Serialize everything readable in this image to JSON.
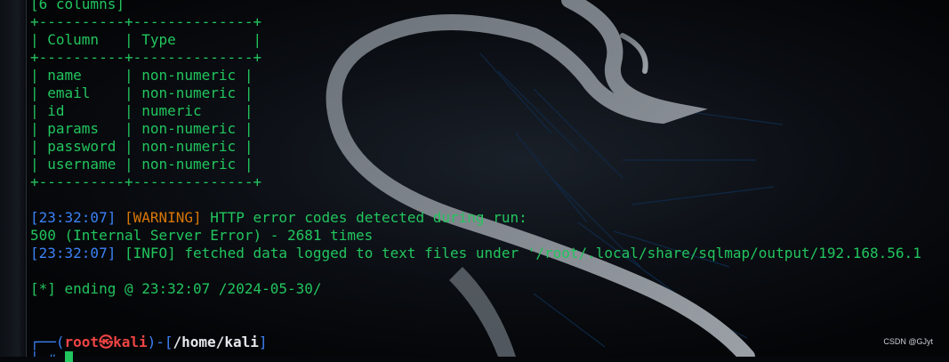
{
  "terminal": {
    "header_line": "[6 columns]",
    "table": {
      "border_top": "+----------+--------------+",
      "header_row": "| Column   | Type         |",
      "border_mid": "+----------+--------------+",
      "rows": [
        "| name     | non-numeric |",
        "| email    | non-numeric |",
        "| id       | numeric     |",
        "| params   | non-numeric |",
        "| password | non-numeric |",
        "| username | non-numeric |"
      ],
      "border_bottom": "+----------+--------------+"
    },
    "log": {
      "warning_time": "[23:32:07]",
      "warning_tag": "[WARNING]",
      "warning_msg": " HTTP error codes detected during run:",
      "error_line": "500 (Internal Server Error) - 2681 times",
      "info_time": "[23:32:07]",
      "info_tag": "[INFO]",
      "info_msg_prefix": " fetched data logged to text files under '",
      "info_path": "/root/.local/share/sqlmap/output/192.168.56.1"
    },
    "ending_line": "[*] ending @ 23:32:07 /2024-05-30/",
    "prompt": {
      "corner": "┌──(",
      "user": "root",
      "skull": "㉿",
      "host": "kali",
      "sep": ")-[",
      "cwd": "/home/kali",
      "close": "]",
      "second_line": "└─#"
    }
  },
  "watermark": "CSDN @GJyt",
  "colors": {
    "text_green": "#22c55e",
    "timestamp_blue": "#3b82f6",
    "warning_orange": "#d97706",
    "prompt_red": "#ef4444",
    "background": "#05070a"
  }
}
